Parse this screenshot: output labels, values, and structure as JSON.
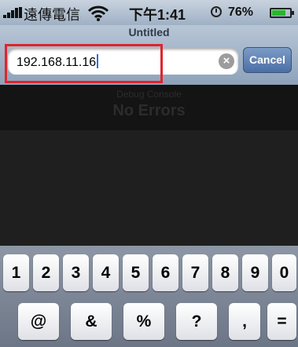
{
  "status_bar": {
    "carrier": "遠傳電信",
    "time": "下午1:41",
    "battery": "76%",
    "battery_level": 0.76,
    "icons": [
      "signal-bars-icon",
      "wifi-icon",
      "clock-indicator-icon",
      "battery-icon"
    ],
    "battery_color": "#2bb62f"
  },
  "nav_bar": {
    "title": "Untitled",
    "url_value": "192.168.11.16",
    "clear_icon": "clear-x-icon",
    "cancel_label": "Cancel",
    "highlight_color": "#e0242c"
  },
  "console": {
    "label": "Debug Console",
    "status": "No Errors"
  },
  "keyboard": {
    "row1": [
      "1",
      "2",
      "3",
      "4",
      "5",
      "6",
      "7",
      "8",
      "9",
      "0"
    ],
    "row2": [
      "@",
      "&",
      "%",
      "?",
      ",",
      "="
    ]
  }
}
